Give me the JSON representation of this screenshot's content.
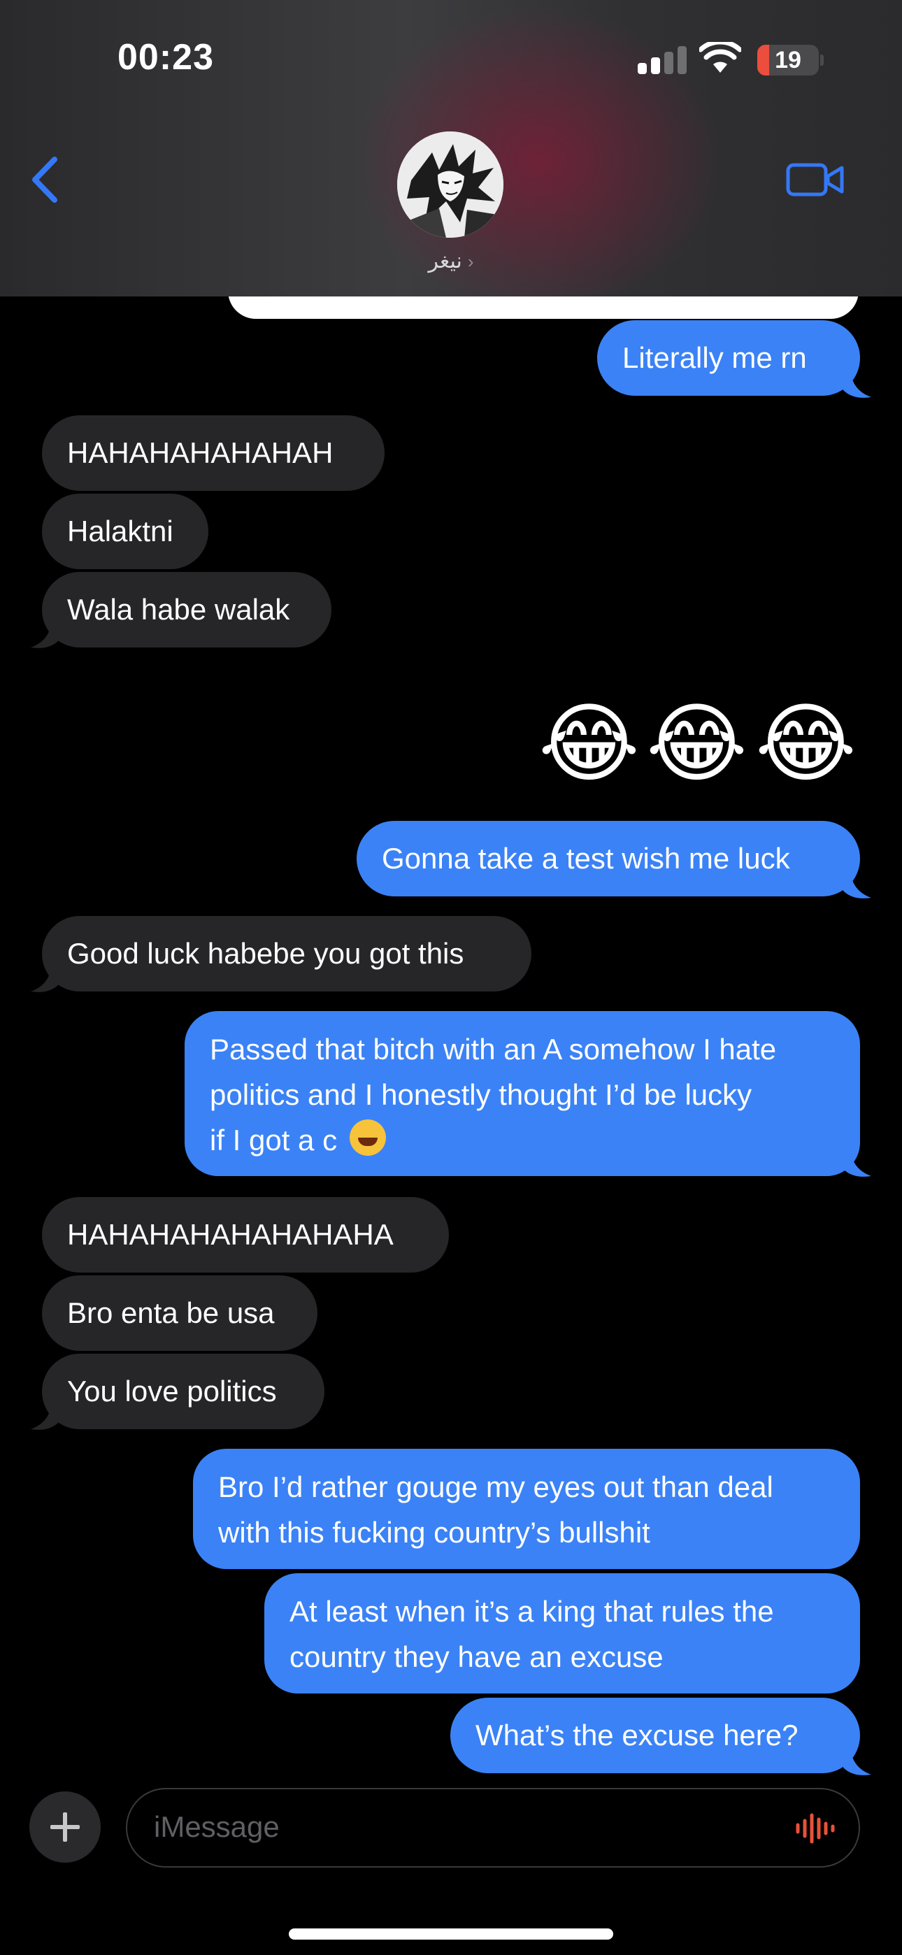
{
  "status_bar": {
    "time": "00:23",
    "battery": "19",
    "battery_level": 0.19
  },
  "header": {
    "contact_name": "نيغر",
    "chevron": "›"
  },
  "messages": [
    {
      "side": "out",
      "text": "Literally me rn"
    },
    {
      "side": "in",
      "text": "HAHAHAHAHAHAH"
    },
    {
      "side": "in",
      "text": "Halaktni"
    },
    {
      "side": "in",
      "text": "Wala habe walak"
    },
    {
      "side": "out",
      "text": "😂😂😂"
    },
    {
      "side": "out",
      "text": "Gonna take a test wish me luck"
    },
    {
      "side": "in",
      "text": "Good luck habebe you got this"
    },
    {
      "side": "out",
      "text": "Passed that bitch with an A somehow I hate politics and I honestly thought I’d be lucky if I got a c 😂"
    },
    {
      "side": "in",
      "text": "HAHAHAHAHAHAHAHA"
    },
    {
      "side": "in",
      "text": "Bro enta be usa"
    },
    {
      "side": "in",
      "text": "You love politics"
    },
    {
      "side": "out",
      "text": "Bro I’d rather gouge my eyes out than deal with this fucking country’s bullshit"
    },
    {
      "side": "out",
      "text": "At least when it’s a king that rules the country they have an excuse"
    },
    {
      "side": "out",
      "text": "What’s the excuse here?"
    }
  ],
  "multiline": {
    "m7": [
      "Passed that bitch with an A somehow I hate",
      "politics and I honestly thought I’d be lucky",
      "if I got a c"
    ],
    "m11": [
      "Bro I’d rather gouge my eyes out than deal",
      "with this fucking country’s bullshit"
    ],
    "m12": [
      "At least when it’s a king that rules the",
      "country they have an excuse"
    ]
  },
  "input": {
    "placeholder": "iMessage"
  },
  "colors": {
    "outgoing": "#3b82f6",
    "incoming": "#262628",
    "background": "#000000",
    "accent": "#3478f6"
  },
  "icons": [
    "back-chevron-icon",
    "video-call-icon",
    "plus-icon",
    "voice-waveform-icon",
    "cellular-signal-icon",
    "wifi-icon",
    "battery-icon"
  ]
}
